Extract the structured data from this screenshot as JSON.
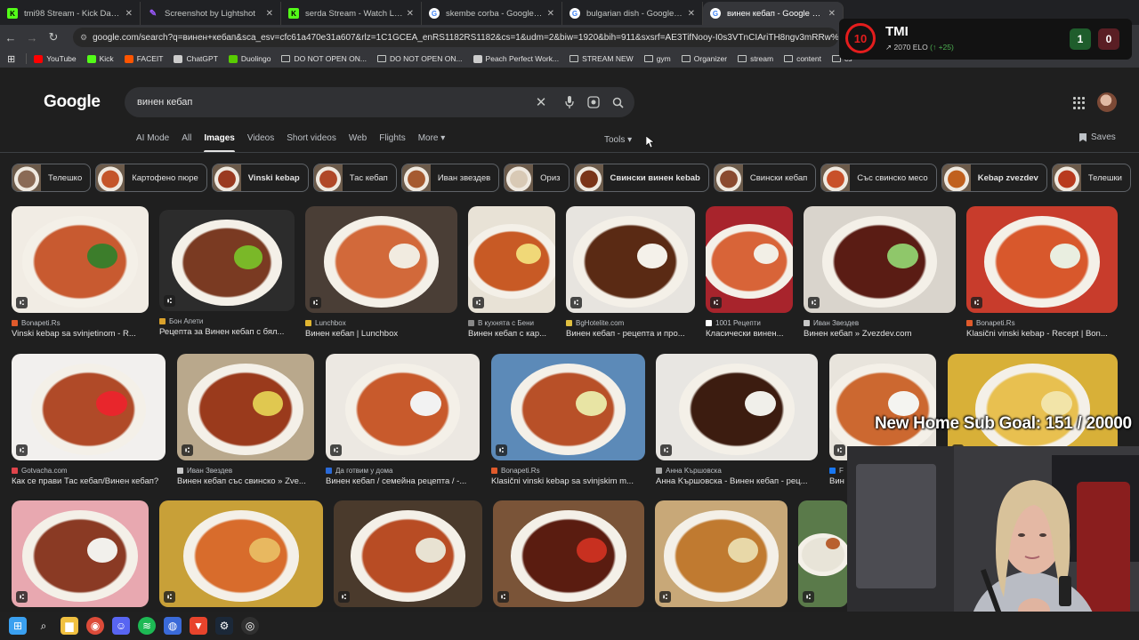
{
  "browser": {
    "tabs": [
      {
        "label": "tmi98 Stream - Kick Dashboard",
        "icon": "kick-icon",
        "color": "#53fc18",
        "active": false
      },
      {
        "label": "Screenshot by Lightshot",
        "icon": "lightshot-icon",
        "color": "#9b59ff",
        "active": false
      },
      {
        "label": "serda Stream - Watch Live on K",
        "icon": "kick-icon",
        "color": "#53fc18",
        "active": false
      },
      {
        "label": "skembe corba - Google Search",
        "icon": "google-icon",
        "color": "#ffffff",
        "active": false
      },
      {
        "label": "bulgarian dish - Google Search",
        "icon": "google-icon",
        "color": "#ffffff",
        "active": false
      },
      {
        "label": "винен кебап - Google Search",
        "icon": "google-icon",
        "color": "#ffffff",
        "active": true
      }
    ],
    "url": "google.com/search?q=винен+кебап&sca_esv=cfc61a470e31a607&rlz=1C1GCEA_enRS1182RS1182&cs=1&udm=2&biw=1920&bih=911&sxsrf=AE3TifNooy-I0s3VTnCIAriTH8ngv3mRRw%3A1761695780",
    "bookmarks": [
      {
        "label": "YouTube",
        "icon": "youtube-icon",
        "color": "#ff0000"
      },
      {
        "label": "Kick",
        "icon": "kick-icon",
        "color": "#53fc18"
      },
      {
        "label": "FACEIT",
        "icon": "faceit-icon",
        "color": "#ff5500"
      },
      {
        "label": "ChatGPT",
        "icon": "chatgpt-icon",
        "color": "#cccccc"
      },
      {
        "label": "Duolingo",
        "icon": "duolingo-icon",
        "color": "#58cc02"
      },
      {
        "label": "DO NOT OPEN ON...",
        "icon": "folder-icon",
        "color": ""
      },
      {
        "label": "DO NOT OPEN ON...",
        "icon": "folder-icon",
        "color": ""
      },
      {
        "label": "Peach Perfect Work...",
        "icon": "web-icon",
        "color": "#cccccc"
      },
      {
        "label": "STREAM NEW",
        "icon": "folder-icon",
        "color": ""
      },
      {
        "label": "gym",
        "icon": "folder-icon",
        "color": ""
      },
      {
        "label": "Organizer",
        "icon": "folder-icon",
        "color": ""
      },
      {
        "label": "stream",
        "icon": "folder-icon",
        "color": ""
      },
      {
        "label": "content",
        "icon": "folder-icon",
        "color": ""
      },
      {
        "label": "cs",
        "icon": "folder-icon",
        "color": ""
      }
    ]
  },
  "google": {
    "logo": "Google",
    "query": "винен кебап",
    "nav": [
      "AI Mode",
      "All",
      "Images",
      "Videos",
      "Short videos",
      "Web",
      "Flights",
      "More ▾"
    ],
    "active_nav": "Images",
    "tools": "Tools ▾",
    "saves": "Saves",
    "chips": [
      {
        "label": "Телешко",
        "bold": false,
        "color": "#8a6a55"
      },
      {
        "label": "Картофено пюре",
        "bold": false,
        "color": "#c4552a"
      },
      {
        "label": "Vinski kebap",
        "bold": true,
        "color": "#9a3a20"
      },
      {
        "label": "Тас кебап",
        "bold": false,
        "color": "#b04828"
      },
      {
        "label": "Иван звездев",
        "bold": false,
        "color": "#a55a30"
      },
      {
        "label": "Ориз",
        "bold": false,
        "color": "#d8c9b5"
      },
      {
        "label": "Свински винен kebab",
        "bold": true,
        "color": "#7a3418"
      },
      {
        "label": "Свински кебап",
        "bold": false,
        "color": "#8a4a30"
      },
      {
        "label": "Със свинско месо",
        "bold": false,
        "color": "#c8502a"
      },
      {
        "label": "Kebap zvezdev",
        "bold": true,
        "color": "#c0601e"
      },
      {
        "label": "Телешки",
        "bold": false,
        "color": "#b83a1e"
      }
    ],
    "results": [
      {
        "source": "Bonapeti.Rs",
        "caption": "Vinski kebap sa svinjetinom - R...",
        "bg": "#f1ece4",
        "plate": "#c85a30",
        "accent": "#3c7d2b",
        "fav": "#e05a2b"
      },
      {
        "source": "Бон Апети",
        "caption": "Рецепта за Винен кебап с бял...",
        "bg": "#2c2c2c",
        "plate": "#7a3a22",
        "accent": "#7ab828",
        "fav": "#d9a12b"
      },
      {
        "source": "Lunchbox",
        "caption": "Винен кебап | Lunchbox",
        "bg": "#4a3e36",
        "plate": "#d2693a",
        "accent": "#f1ebe0",
        "fav": "#e0b530"
      },
      {
        "source": "В кухнята с Бени",
        "caption": "Винен кебап с кар...",
        "bg": "#e8e2d6",
        "plate": "#c85a25",
        "accent": "#f0d878",
        "fav": "#888888"
      },
      {
        "source": "BgHotelite.com",
        "caption": "Винен кебап - рецепта и про...",
        "bg": "#e7e4df",
        "plate": "#5a2a14",
        "accent": "#f4f1ea",
        "fav": "#e0c040"
      },
      {
        "source": "1001 Рецепти",
        "caption": "Класически винен...",
        "bg": "#a8242c",
        "plate": "#d86438",
        "accent": "#f2efe6",
        "fav": "#ffffff"
      },
      {
        "source": "Иван Звездев",
        "caption": "Винен кебап » Zvezdev.com",
        "bg": "#d9d4cc",
        "plate": "#5a1c14",
        "accent": "#8fc76a",
        "fav": "#c8c8c8"
      },
      {
        "source": "Bonapeti.Rs",
        "caption": "Klasični vinski kebap - Recept | Bon...",
        "bg": "#c83c2c",
        "plate": "#d8582c",
        "accent": "#e9eee0",
        "fav": "#e05a2b"
      },
      {
        "source": "Gotvacha.com",
        "caption": "Как се прави Тас кебап/Винен кебап?",
        "bg": "#f2f0ee",
        "plate": "#b04a28",
        "accent": "#e8262c",
        "fav": "#e0444b"
      },
      {
        "source": "Иван Звездев",
        "caption": "Винен кебап със свинско » Zve...",
        "bg": "#b9a88c",
        "plate": "#9a3a1c",
        "accent": "#e0c850",
        "fav": "#c8c8c8"
      },
      {
        "source": "Да готвим у дома",
        "caption": "Винен кебап / семейна рецепта / -...",
        "bg": "#ece8e2",
        "plate": "#c85a2c",
        "accent": "#f2f2f2",
        "fav": "#2a6ad8"
      },
      {
        "source": "Bonapeti.Rs",
        "caption": "Klasični vinski kebap sa svinjskim m...",
        "bg": "#5c8ab8",
        "plate": "#b85028",
        "accent": "#e8e4a4",
        "fav": "#e05a2b"
      },
      {
        "source": "Анна Kършовска",
        "caption": "Анна Kършовска - Винен кебап - рец...",
        "bg": "#e8e6e2",
        "plate": "#3c1c10",
        "accent": "#f0efea",
        "fav": "#aaaaaa"
      },
      {
        "source": "F",
        "caption": "Вин",
        "bg": "#e8e4dc",
        "plate": "#cc6830",
        "accent": "#f4f4f0",
        "fav": "#1877f2"
      },
      {
        "source": "",
        "caption": "",
        "bg": "#d8b038",
        "plate": "#e8c050",
        "accent": "#f2e4a8",
        "fav": ""
      },
      {
        "source": "",
        "caption": "",
        "bg": "#e8a8b0",
        "plate": "#8a3a24",
        "accent": "#f2f0ec",
        "fav": ""
      },
      {
        "source": "",
        "caption": "",
        "bg": "#c8a038",
        "plate": "#d86c2c",
        "accent": "#e8b860",
        "fav": ""
      },
      {
        "source": "",
        "caption": "",
        "bg": "#4a3a2c",
        "plate": "#b84c24",
        "accent": "#e8e2d2",
        "fav": ""
      },
      {
        "source": "",
        "caption": "",
        "bg": "#7a5438",
        "plate": "#5a1c10",
        "accent": "#c83020",
        "fav": ""
      },
      {
        "source": "",
        "caption": "",
        "bg": "#c8a878",
        "plate": "#c07a30",
        "accent": "#e8d8a8",
        "fav": ""
      },
      {
        "source": "",
        "caption": "",
        "bg": "#5a7a4a",
        "plate": "#e8e4d8",
        "accent": "#b86030",
        "fav": ""
      }
    ]
  },
  "overlay": {
    "faceit_level": "10",
    "faceit_name": "TMI",
    "faceit_elo": "2070 ELO",
    "faceit_gain": "(↑ +25)",
    "score_win": "1",
    "score_loss": "0",
    "sub_goal": "New Home Sub Goal:  151 / 20000"
  },
  "taskbar": [
    "windows-icon",
    "search-icon",
    "file-explorer-icon",
    "chrome-icon",
    "discord-icon",
    "spotify-icon",
    "app-icon",
    "brave-icon",
    "steam-icon",
    "obs-icon"
  ]
}
